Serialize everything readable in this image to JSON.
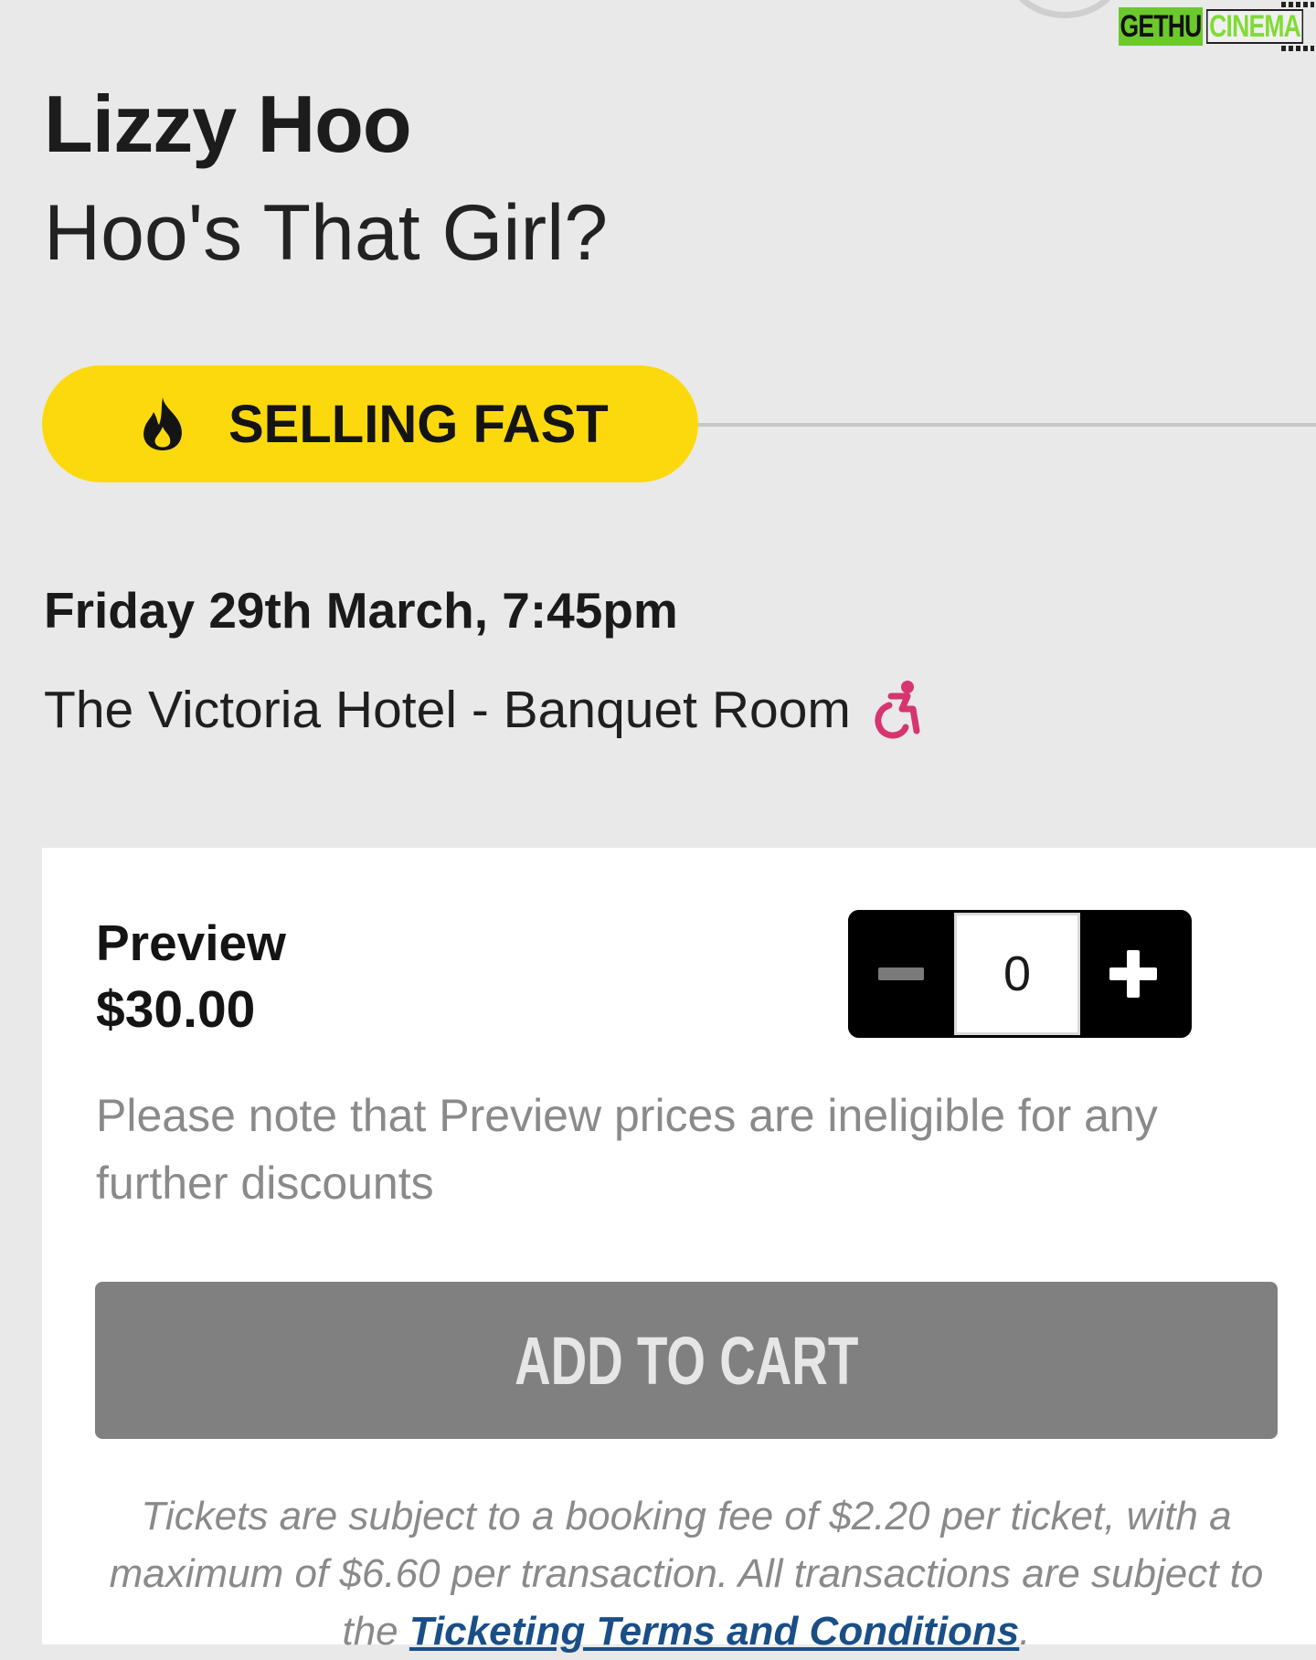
{
  "watermark": {
    "left": "GETHU",
    "right": "CINEMA"
  },
  "event": {
    "artist": "Lizzy Hoo",
    "show_title": "Hoo's That Girl?",
    "badge_label": "SELLING FAST",
    "badge_icon": "fire-icon",
    "date": "Friday 29th March, 7:45pm",
    "venue": "The Victoria Hotel - Banquet Room",
    "venue_icon": "wheelchair-accessible-icon"
  },
  "ticket": {
    "name": "Preview",
    "price": "$30.00",
    "quantity": "0",
    "decrease_icon": "minus-icon",
    "increase_icon": "plus-icon",
    "note": "Please note that Preview prices are ineligible for any further discounts"
  },
  "cart": {
    "add_label": "ADD TO CART"
  },
  "fine_print": {
    "text": "Tickets are subject to a booking fee of $2.20 per ticket, with a maximum of $6.60 per transaction. All transactions are subject to the ",
    "link": "Ticketing Terms and Conditions",
    "end": "."
  },
  "colors": {
    "background": "#e9e9e9",
    "badge": "#fcd90d",
    "accessibility": "#d6356f",
    "button_disabled": "#808080",
    "link": "#1a4e87"
  }
}
